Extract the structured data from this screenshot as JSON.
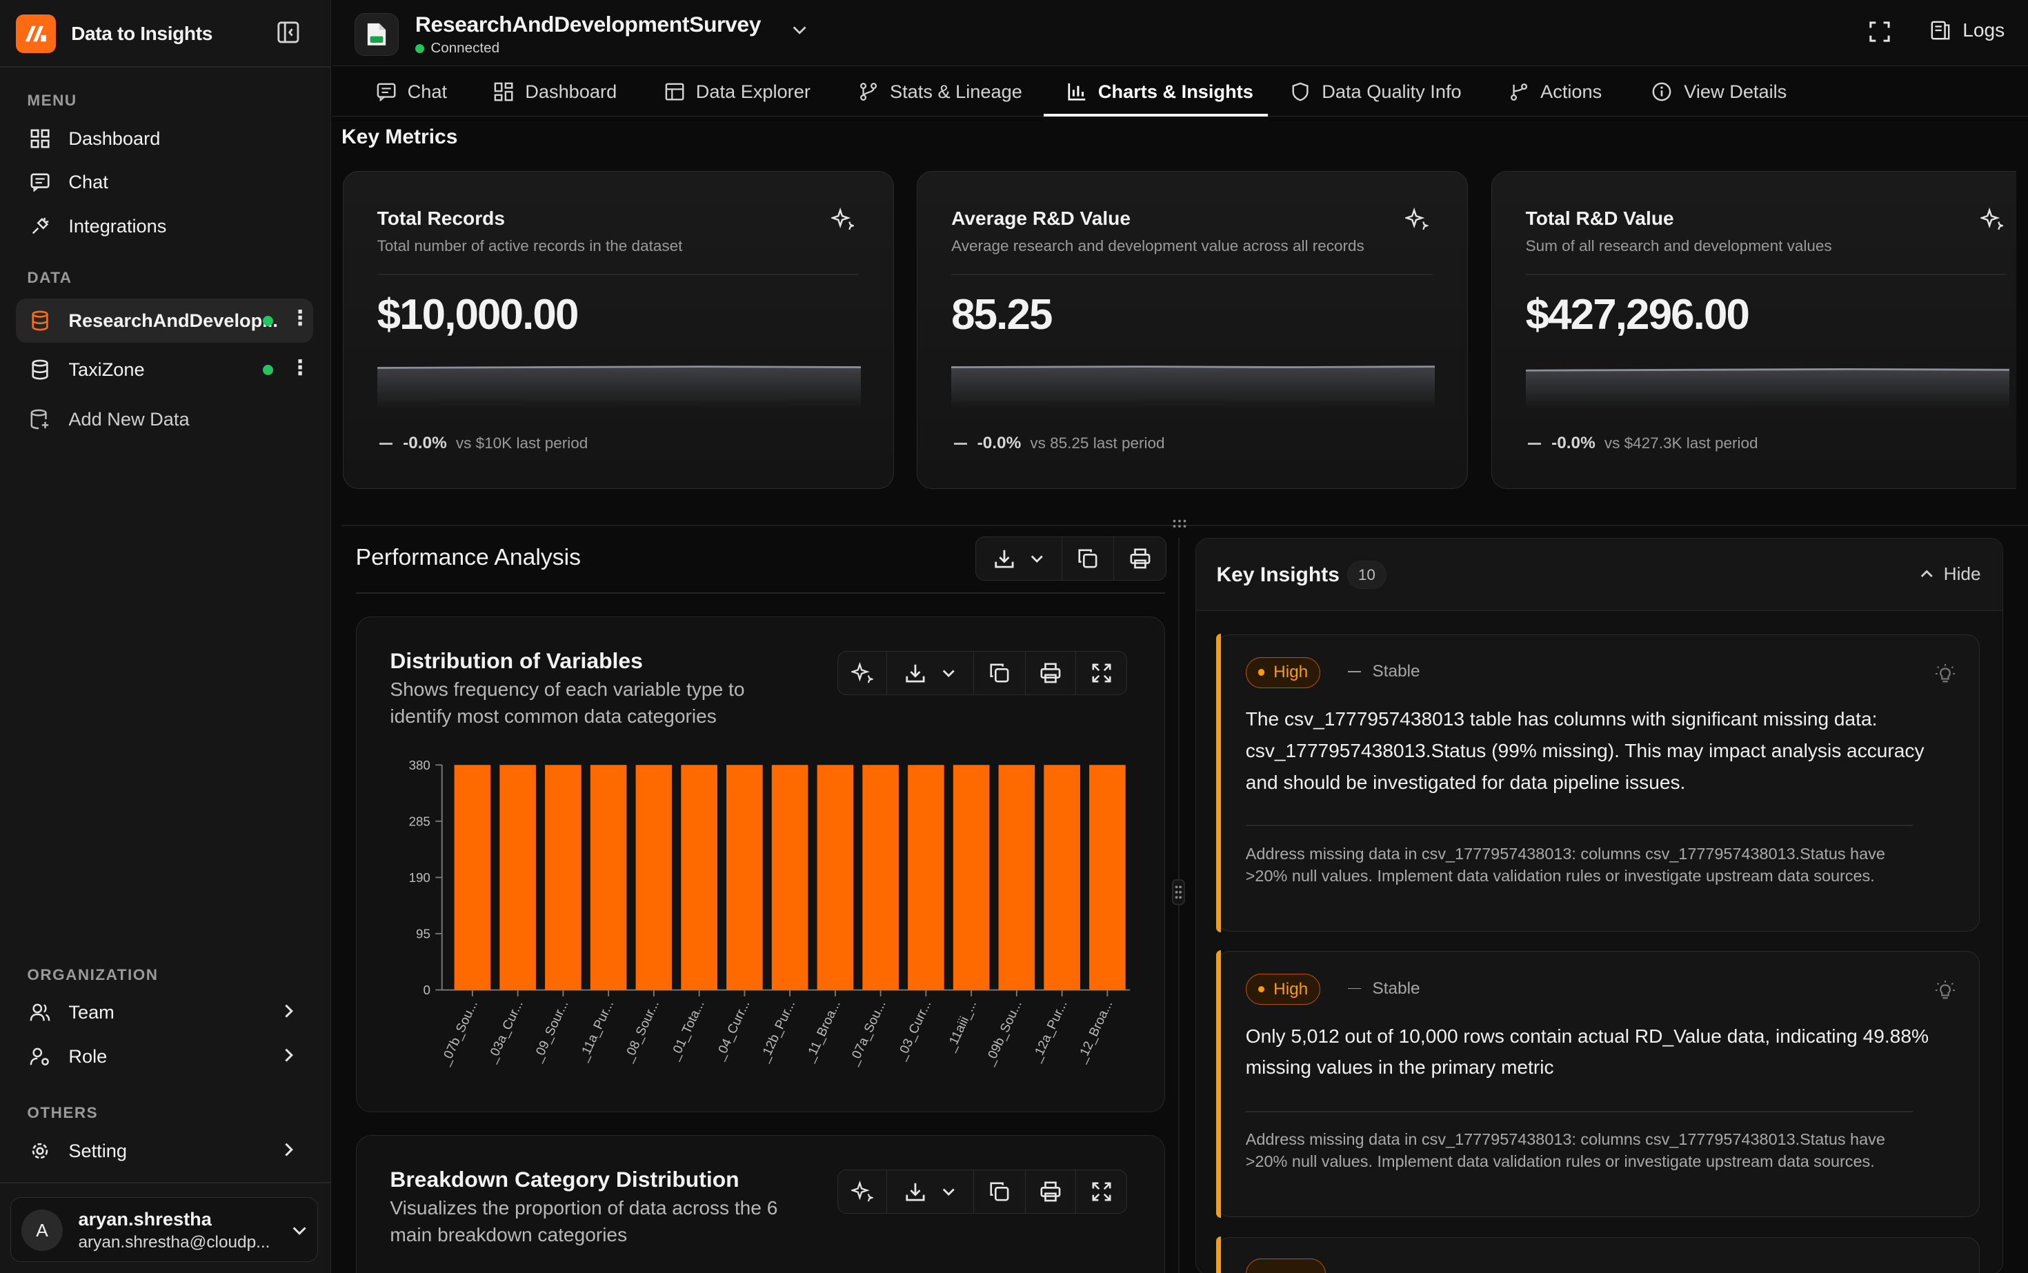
{
  "app": {
    "name": "Data to Insights"
  },
  "sidebar": {
    "menu_label": "MENU",
    "menu": [
      {
        "label": "Dashboard",
        "icon": "dashboard-icon"
      },
      {
        "label": "Chat",
        "icon": "chat-icon"
      },
      {
        "label": "Integrations",
        "icon": "plug-icon"
      }
    ],
    "data_label": "DATA",
    "data_sources": [
      {
        "label": "ResearchAndDevelop...",
        "status": "connected",
        "active": true
      },
      {
        "label": "TaxiZone",
        "status": "connected",
        "active": false
      }
    ],
    "add_data": "Add New Data",
    "org_label": "ORGANIZATION",
    "org": [
      {
        "label": "Team"
      },
      {
        "label": "Role"
      }
    ],
    "others_label": "OTHERS",
    "others": [
      {
        "label": "Setting"
      }
    ],
    "user": {
      "initial": "A",
      "name": "aryan.shrestha",
      "email": "aryan.shrestha@cloudp..."
    }
  },
  "header": {
    "dataset_title": "ResearchAndDevelopmentSurvey",
    "status": "Connected",
    "logs_label": "Logs"
  },
  "tabs": [
    {
      "label": "Chat",
      "icon": "chat-icon"
    },
    {
      "label": "Dashboard",
      "icon": "dashboard-icon"
    },
    {
      "label": "Data Explorer",
      "icon": "table-icon"
    },
    {
      "label": "Stats & Lineage",
      "icon": "lineage-icon"
    },
    {
      "label": "Charts & Insights",
      "icon": "bar-chart-icon",
      "active": true
    },
    {
      "label": "Data Quality Info",
      "icon": "shield-icon"
    },
    {
      "label": "Actions",
      "icon": "actions-icon"
    },
    {
      "label": "View Details",
      "icon": "info-icon"
    }
  ],
  "key_metrics": {
    "title": "Key Metrics",
    "cards": [
      {
        "title": "Total Records",
        "subtitle": "Total number of active records in the dataset",
        "value": "$10,000.00",
        "change": "-0.0%",
        "compare": "vs $10K last period"
      },
      {
        "title": "Average R&D Value",
        "subtitle": "Average research and development value across all records",
        "value": "85.25",
        "change": "-0.0%",
        "compare": "vs 85.25 last period"
      },
      {
        "title": "Total R&D Value",
        "subtitle": "Sum of all research and development values",
        "value": "$427,296.00",
        "change": "-0.0%",
        "compare": "vs $427.3K last period"
      }
    ]
  },
  "performance": {
    "title": "Performance Analysis",
    "charts": [
      {
        "title": "Distribution of Variables",
        "subtitle": "Shows frequency of each variable type to identify most common data categories"
      },
      {
        "title": "Breakdown Category Distribution",
        "subtitle": "Visualizes the proportion of data across the 6 main breakdown categories"
      }
    ]
  },
  "chart_data": {
    "type": "bar",
    "title": "Distribution of Variables",
    "categories": [
      "_07b_Sou...",
      "_03a_Cur...",
      "_09_Sour...",
      "_11a_Pur...",
      "_08_Sour...",
      "_01_Tota...",
      "_04_Curr...",
      "_12b_Pur...",
      "_11_Broa...",
      "_07a_Sou...",
      "_03_Curr...",
      "_11aiii_...",
      "_09b_Sou...",
      "_12a_Pur...",
      "_12_Broa..."
    ],
    "values": [
      380,
      380,
      380,
      380,
      380,
      380,
      380,
      380,
      380,
      380,
      380,
      380,
      380,
      380,
      380
    ],
    "y_ticks": [
      "0",
      "95",
      "190",
      "285",
      "380"
    ],
    "ylim": [
      0,
      380
    ],
    "color": "#ff6a00"
  },
  "insights": {
    "title": "Key Insights",
    "count": "10",
    "hide_label": "Hide",
    "items": [
      {
        "priority": "High",
        "trend": "Stable",
        "text": "The csv_1777957438013 table has columns with significant missing data: csv_1777957438013.Status (99% missing). This may impact analysis accuracy and should be investigated for data pipeline issues.",
        "recommendation": "Address missing data in csv_1777957438013: columns csv_1777957438013.Status have >20% null values. Implement data validation rules or investigate upstream data sources."
      },
      {
        "priority": "High",
        "trend": "Stable",
        "text": "Only 5,012 out of 10,000 rows contain actual RD_Value data, indicating 49.88% missing values in the primary metric",
        "recommendation": "Address missing data in csv_1777957438013: columns csv_1777957438013.Status have >20% null values. Implement data validation rules or investigate upstream data sources."
      }
    ]
  },
  "colors": {
    "accent": "#ff6a13",
    "bar": "#ff6a00",
    "warning": "#f59e0b",
    "success": "#22c55e"
  }
}
